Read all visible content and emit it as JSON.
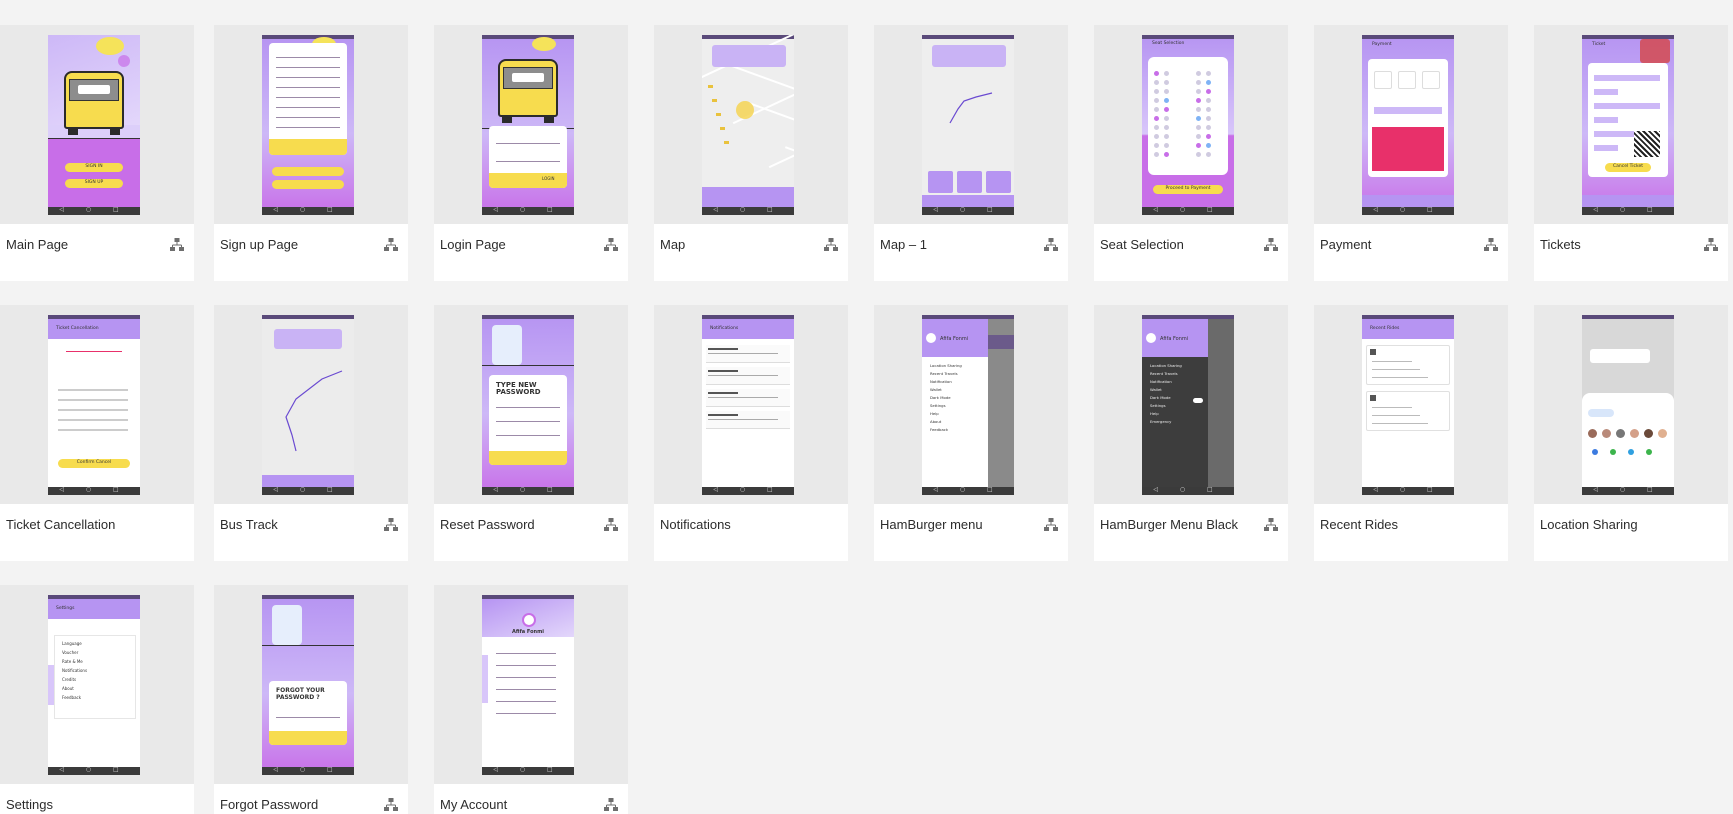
{
  "colors": {
    "background": "#f3f3f3",
    "thumbnail_bg": "#e9e9e9",
    "footer_bg": "#ffffff",
    "accent_purple": "#b694f2",
    "accent_magenta": "#c86ee8",
    "accent_yellow": "#f7dc4e",
    "accent_pink": "#e8306a",
    "dark_menu": "#3d3d3d"
  },
  "artboards": [
    {
      "title": "Main Page",
      "has_flow_icon": true
    },
    {
      "title": "Sign up Page",
      "has_flow_icon": true
    },
    {
      "title": "Login Page",
      "has_flow_icon": true
    },
    {
      "title": "Map",
      "has_flow_icon": true
    },
    {
      "title": "Map – 1",
      "has_flow_icon": true
    },
    {
      "title": "Seat Selection",
      "has_flow_icon": true
    },
    {
      "title": "Payment",
      "has_flow_icon": true
    },
    {
      "title": "Tickets",
      "has_flow_icon": true
    },
    {
      "title": "Ticket Cancellation",
      "has_flow_icon": false
    },
    {
      "title": "Bus Track",
      "has_flow_icon": true
    },
    {
      "title": "Reset Password",
      "has_flow_icon": true
    },
    {
      "title": "Notifications",
      "has_flow_icon": false
    },
    {
      "title": "HamBurger menu",
      "has_flow_icon": true
    },
    {
      "title": "HamBurger Menu Black",
      "has_flow_icon": true
    },
    {
      "title": "Recent Rides",
      "has_flow_icon": false
    },
    {
      "title": "Location Sharing",
      "has_flow_icon": false
    },
    {
      "title": "Settings",
      "has_flow_icon": false
    },
    {
      "title": "Forgot Password",
      "has_flow_icon": true
    },
    {
      "title": "My Account",
      "has_flow_icon": true
    }
  ],
  "screens": {
    "main": {
      "button_1": "SIGN IN",
      "button_2": "SIGN UP"
    },
    "login": {
      "action": "LOGIN"
    },
    "seat": {
      "header": "Seat Selection",
      "button": "Proceed to Payment"
    },
    "payment": {
      "header": "Payment"
    },
    "tickets": {
      "header": "Ticket",
      "button": "Cancel Ticket"
    },
    "cancellation": {
      "header": "Ticket Cancellation",
      "button": "Confirm Cancel"
    },
    "reset": {
      "heading_1": "TYPE NEW",
      "heading_2": "PASSWORD"
    },
    "notifications": {
      "header": "Notifications"
    },
    "hamburger": {
      "user": "Afifa Fonmi",
      "items": [
        "Location Sharing",
        "Recent Travels",
        "Notification",
        "Wallet",
        "Dark Mode",
        "Settings",
        "Help",
        "About",
        "Feedback"
      ]
    },
    "hamburger_black": {
      "user": "Afifa Fonmi",
      "items": [
        "Location Sharing",
        "Recent Travels",
        "Notification",
        "Wallet",
        "Dark Mode",
        "Settings",
        "Help",
        "Emergency"
      ]
    },
    "recent": {
      "header": "Recent Rides"
    },
    "settings": {
      "header": "Settings",
      "items": [
        "Language",
        "Voucher",
        "Rate & Me",
        "Notifications",
        "Credits",
        "About",
        "Feedback"
      ]
    },
    "forgot": {
      "heading_1": "FORGOT YOUR",
      "heading_2": "PASSWORD ?"
    },
    "account": {
      "user": "Afifa Fonmi"
    }
  }
}
